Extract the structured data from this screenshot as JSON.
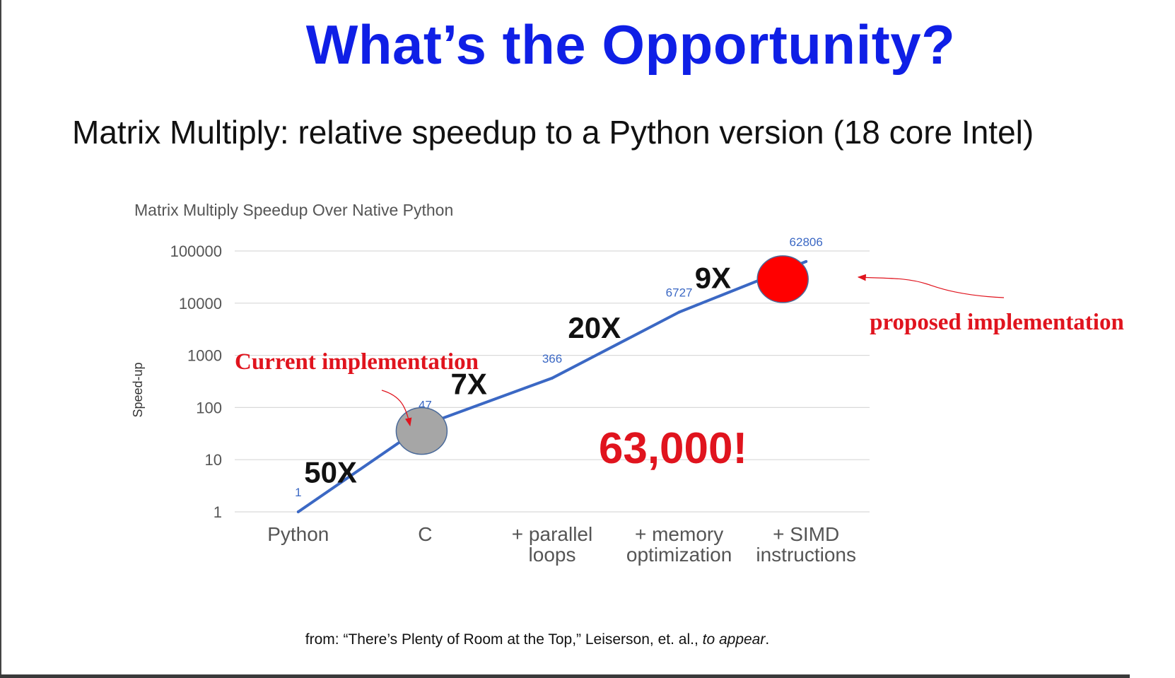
{
  "slide": {
    "title": "What’s the Opportunity?",
    "subtitle": "Matrix Multiply: relative speedup to a Python version (18 core Intel)",
    "citation_prefix": "from: “There’s Plenty of Room at the Top,” Leiserson, et. al., ",
    "citation_italic": "to appear",
    "citation_suffix": "."
  },
  "chart_data": {
    "type": "line",
    "title": "Matrix Multiply Speedup Over Native Python",
    "xlabel": "",
    "ylabel": "Speed-up",
    "yscale": "log",
    "ylim": [
      1,
      100000
    ],
    "yticks": [
      "100000",
      "10000",
      "1000",
      "100",
      "10",
      "1"
    ],
    "grid": true,
    "categories": [
      [
        "Python"
      ],
      [
        "C"
      ],
      [
        "+ parallel",
        "loops"
      ],
      [
        "+ memory",
        "optimization"
      ],
      [
        "+ SIMD",
        "instructions"
      ]
    ],
    "series": [
      {
        "values": [
          1,
          47,
          366,
          6727,
          62806
        ],
        "labels": [
          "1",
          "47",
          "366",
          "6727",
          "62806"
        ],
        "color": "#3b68c4"
      }
    ],
    "step_labels": [
      "50X",
      "7X",
      "20X",
      "9X"
    ],
    "annotations": {
      "current": "Current implementation",
      "proposed": "proposed implementation",
      "total": "63,000!"
    },
    "colors": {
      "line": "#3b68c4",
      "annotation_red": "#e0141e",
      "current_marker": "#a6a6a6",
      "proposed_marker": "#ff0000",
      "grid": "#d9d9d9",
      "tick_text": "#555555",
      "value_label": "#3b68c4"
    }
  }
}
